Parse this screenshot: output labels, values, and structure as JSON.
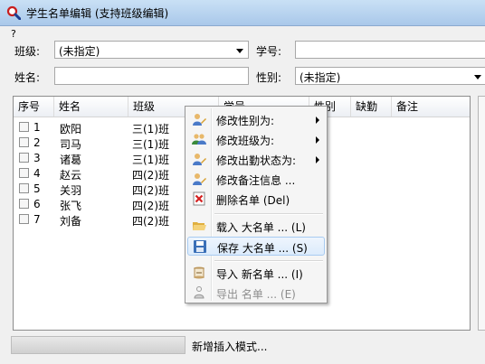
{
  "window": {
    "title": "学生名单编辑 (支持班级编辑)"
  },
  "menubar": {
    "help": "?"
  },
  "form": {
    "class_label": "班级:",
    "class_value": "(未指定)",
    "student_no_label": "学号:",
    "name_label": "姓名:",
    "gender_label": "性别:",
    "gender_value": "(未指定)"
  },
  "table": {
    "columns": [
      "序号",
      "姓名",
      "班级",
      "学号",
      "性别",
      "缺勤",
      "备注"
    ],
    "rows": [
      {
        "no": "1",
        "name": "欧阳",
        "class": "三(1)班"
      },
      {
        "no": "2",
        "name": "司马",
        "class": "三(1)班"
      },
      {
        "no": "3",
        "name": "诸葛",
        "class": "三(1)班"
      },
      {
        "no": "4",
        "name": "赵云",
        "class": "四(2)班"
      },
      {
        "no": "5",
        "name": "关羽",
        "class": "四(2)班"
      },
      {
        "no": "6",
        "name": "张飞",
        "class": "四(2)班"
      },
      {
        "no": "7",
        "name": "刘备",
        "class": "四(2)班"
      }
    ]
  },
  "context_menu": {
    "items": [
      {
        "label": "修改性别为:",
        "icon": "edit-person-icon"
      },
      {
        "label": "修改班级为:",
        "icon": "group-icon"
      },
      {
        "label": "修改出勤状态为:",
        "icon": "edit-person-icon"
      },
      {
        "label": "修改备注信息 ...",
        "icon": "edit-person-icon"
      },
      {
        "label": "删除名单 (Del)",
        "icon": "delete-icon"
      },
      {
        "label": "载入 大名单 ... (L)",
        "icon": "folder-open-icon"
      },
      {
        "label": "保存 大名单 ... (S)",
        "icon": "save-icon"
      },
      {
        "label": "导入 新名单 ... (I)",
        "icon": "import-icon"
      },
      {
        "label": "导出 名单 ... (E)",
        "icon": "export-icon"
      }
    ]
  },
  "status": {
    "text": "新增插入模式..."
  },
  "colors": {
    "highlight": "#dcebfc",
    "delete_red": "#d42020",
    "save_blue": "#3a6fb7"
  }
}
